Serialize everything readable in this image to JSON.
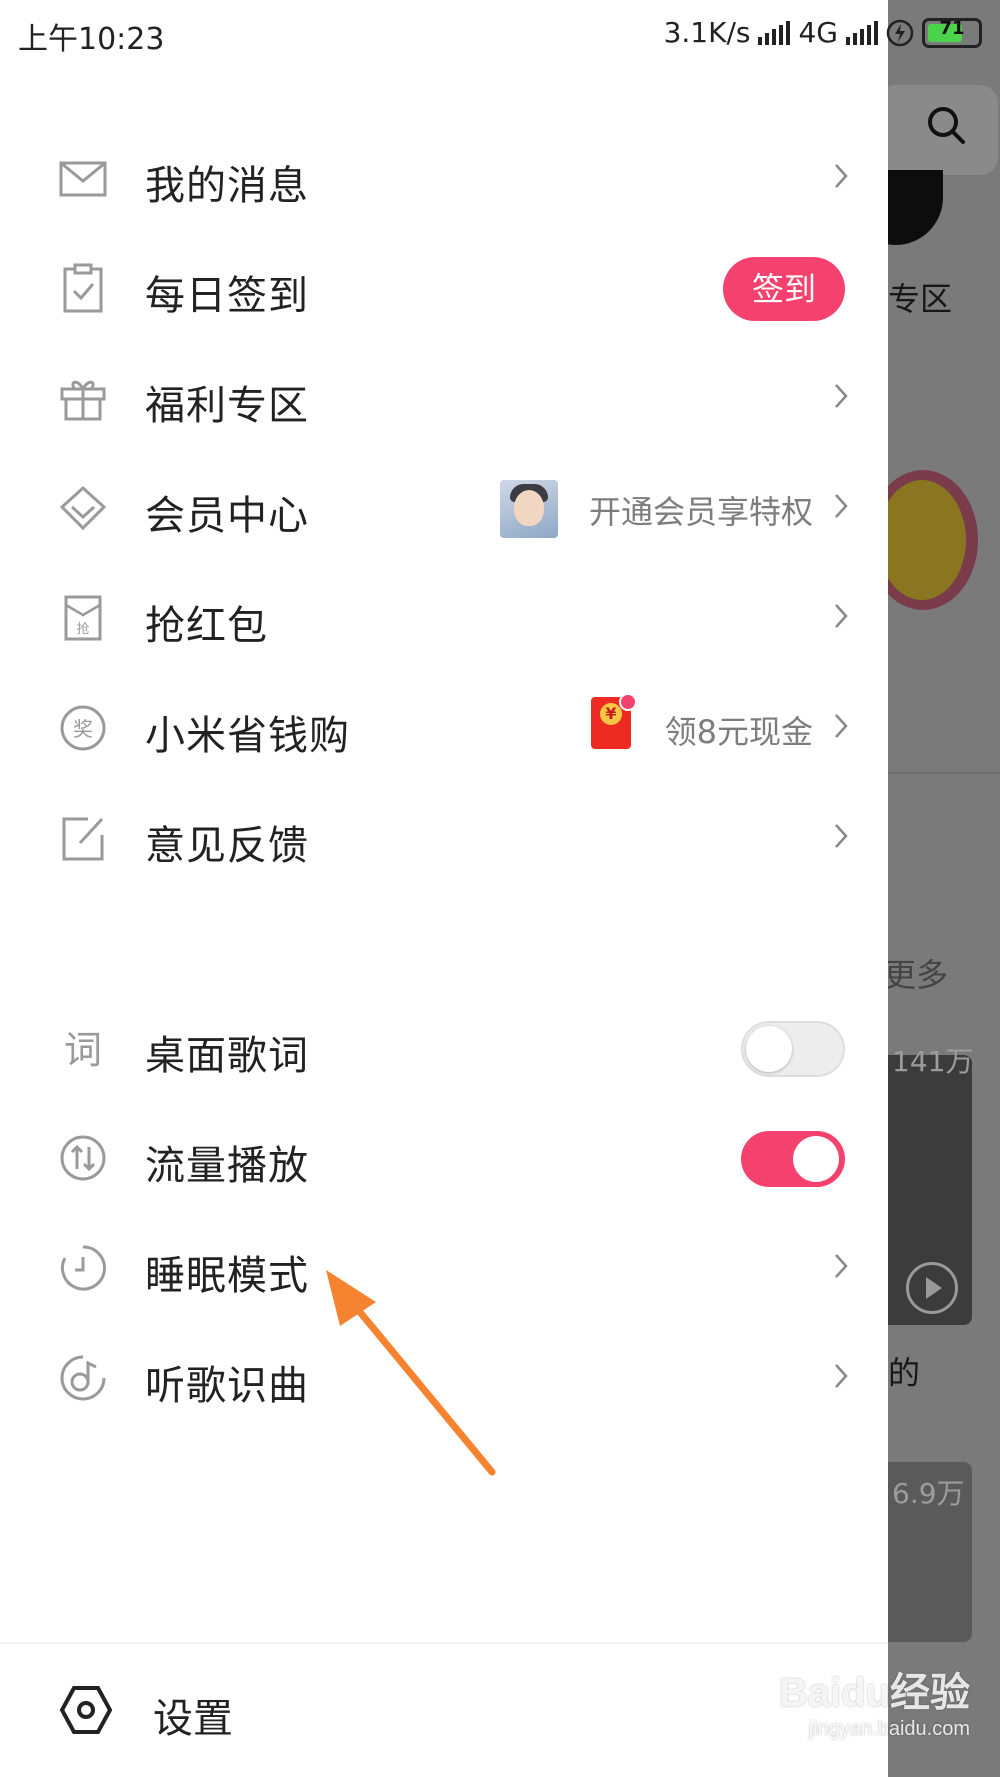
{
  "status_bar": {
    "time": "上午10:23",
    "net_speed": "3.1K/s",
    "network": "4G",
    "battery": "71"
  },
  "menu": {
    "messages": "我的消息",
    "checkin": "每日签到",
    "checkin_button": "签到",
    "welfare": "福利专区",
    "vip": "会员中心",
    "vip_hint": "开通会员享特权",
    "red_packet": "抢红包",
    "xiaomi_shop": "小米省钱购",
    "xiaomi_hint": "领8元现金",
    "feedback": "意见反馈",
    "desktop_lyrics": "桌面歌词",
    "desktop_lyrics_on": false,
    "data_playback": "流量播放",
    "data_playback_on": true,
    "sleep_mode": "睡眠模式",
    "song_recognition": "听歌识曲"
  },
  "footer": {
    "settings": "设置"
  },
  "background": {
    "zone_label": "专区",
    "more_label": "更多",
    "count1": "141万",
    "song_char": "的",
    "count2": "6.9万"
  },
  "watermark": {
    "brand": "Baidu经验",
    "url": "jingyan.baidu.com"
  },
  "colors": {
    "accent": "#f5416e",
    "arrow": "#f5832f",
    "icon": "#9a9a9a"
  }
}
